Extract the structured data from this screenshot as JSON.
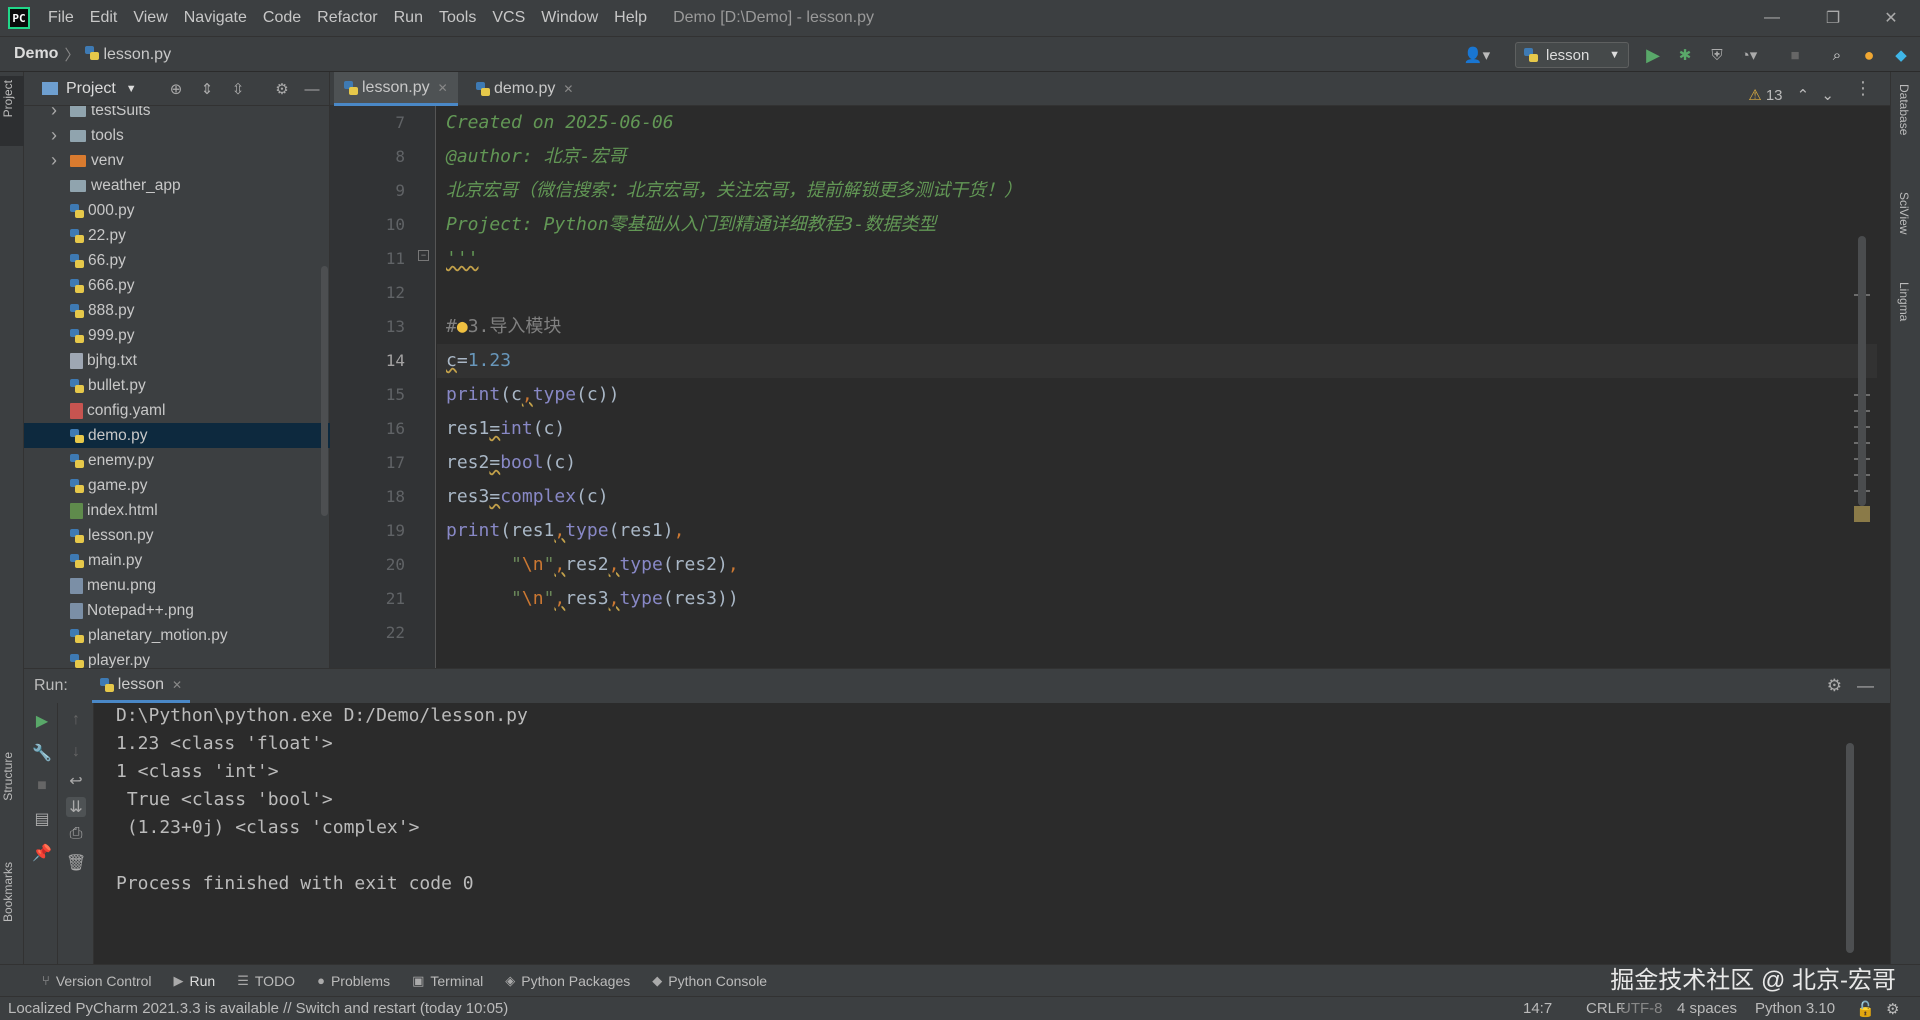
{
  "window": {
    "title": "Demo [D:\\Demo] - lesson.py",
    "menus": [
      "File",
      "Edit",
      "View",
      "Navigate",
      "Code",
      "Refactor",
      "Run",
      "Tools",
      "VCS",
      "Window",
      "Help"
    ],
    "controls": {
      "minimize": "—",
      "restore": "❐",
      "close": "✕"
    }
  },
  "navbar": {
    "project": "Demo",
    "file": "lesson.py",
    "run_config": "lesson"
  },
  "left_strip": {
    "project": "Project",
    "structure": "Structure",
    "bookmarks": "Bookmarks"
  },
  "right_strip": {
    "database": "Database",
    "sciview": "SciView",
    "lingma": "Lingma"
  },
  "project_pane": {
    "title": "Project",
    "items": [
      {
        "name": "testSuits",
        "type": "folder",
        "expandable": true
      },
      {
        "name": "tools",
        "type": "folder",
        "expandable": true
      },
      {
        "name": "venv",
        "type": "folder-orange",
        "expandable": true
      },
      {
        "name": "weather_app",
        "type": "folder",
        "expandable": false
      },
      {
        "name": "000.py",
        "type": "py"
      },
      {
        "name": "22.py",
        "type": "py"
      },
      {
        "name": "66.py",
        "type": "py"
      },
      {
        "name": "666.py",
        "type": "py"
      },
      {
        "name": "888.py",
        "type": "py"
      },
      {
        "name": "999.py",
        "type": "py"
      },
      {
        "name": "bjhg.txt",
        "type": "txt"
      },
      {
        "name": "bullet.py",
        "type": "py"
      },
      {
        "name": "config.yaml",
        "type": "yaml"
      },
      {
        "name": "demo.py",
        "type": "py",
        "selected": true
      },
      {
        "name": "enemy.py",
        "type": "py"
      },
      {
        "name": "game.py",
        "type": "py"
      },
      {
        "name": "index.html",
        "type": "html"
      },
      {
        "name": "lesson.py",
        "type": "py"
      },
      {
        "name": "main.py",
        "type": "py"
      },
      {
        "name": "menu.png",
        "type": "img"
      },
      {
        "name": "Notepad++.png",
        "type": "img"
      },
      {
        "name": "planetary_motion.py",
        "type": "py"
      },
      {
        "name": "player.py",
        "type": "py"
      }
    ]
  },
  "editor": {
    "tabs": [
      {
        "label": "lesson.py",
        "active": true
      },
      {
        "label": "demo.py",
        "active": false
      }
    ],
    "warnings": "13",
    "line_numbers": [
      "7",
      "8",
      "9",
      "10",
      "11",
      "12",
      "13",
      "14",
      "15",
      "16",
      "17",
      "18",
      "19",
      "20",
      "21",
      "22"
    ],
    "current_line": "14"
  },
  "run_panel": {
    "label": "Run:",
    "tab": "lesson",
    "output": [
      "D:\\Python\\python.exe D:/Demo/lesson.py",
      "1.23 <class 'float'>",
      "1 <class 'int'>",
      " True <class 'bool'>",
      " (1.23+0j) <class 'complex'>",
      "",
      "Process finished with exit code 0"
    ]
  },
  "bottom_tabs": [
    "Version Control",
    "Run",
    "TODO",
    "Problems",
    "Terminal",
    "Python Packages",
    "Python Console"
  ],
  "watermark": "掘金技术社区 @ 北京-宏哥",
  "status": {
    "message": "Localized PyCharm 2021.3.3 is available // Switch and restart (today 10:05)",
    "position": "14:7",
    "line_sep": "CRLF",
    "encoding": "UTF-8",
    "indent": "4 spaces",
    "interpreter": "Python 3.10"
  },
  "colors": {
    "accent": "#4a88c7",
    "doc_green": "#629755",
    "keyword": "#8888c6",
    "number": "#6897bb",
    "orange": "#cc7832"
  }
}
